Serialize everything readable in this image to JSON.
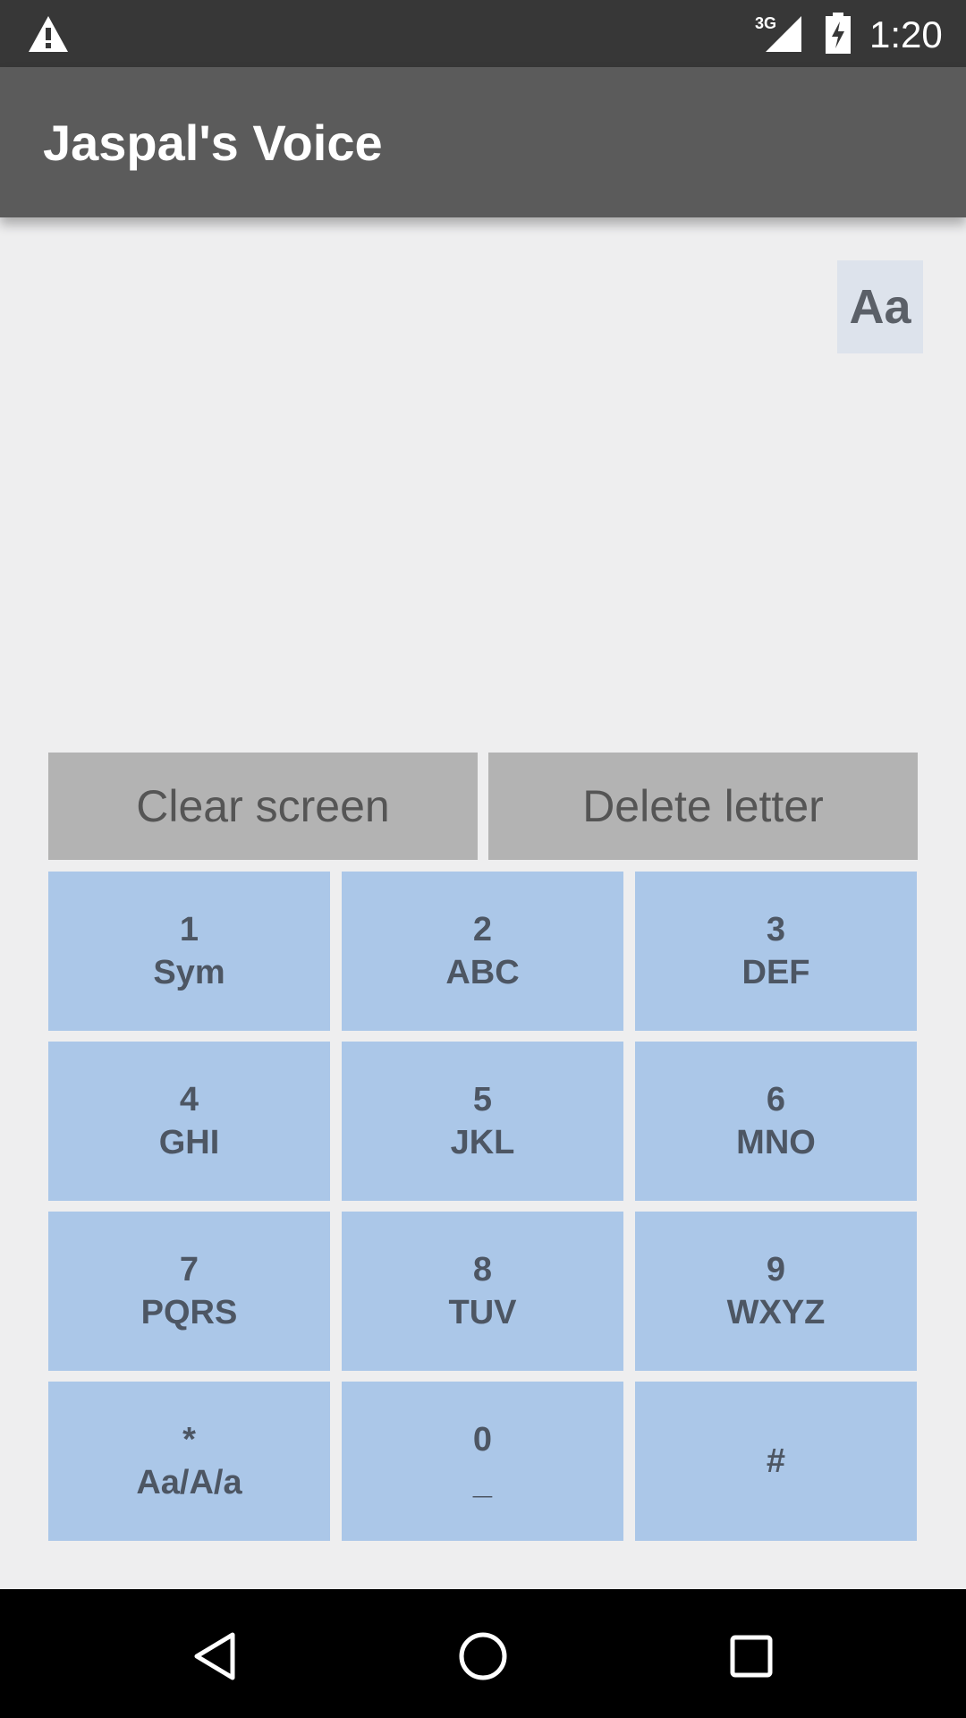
{
  "status_bar": {
    "time": "1:20",
    "network": "3G",
    "warning_icon": "warning-icon",
    "signal_icon": "signal-icon",
    "battery_icon": "battery-charging-icon"
  },
  "app_bar": {
    "title": "Jaspal's Voice"
  },
  "text_area": {
    "case_toggle_label": "Aa"
  },
  "actions": {
    "clear_label": "Clear screen",
    "delete_label": "Delete letter"
  },
  "keypad": {
    "keys": [
      {
        "main": "1",
        "sub": "Sym"
      },
      {
        "main": "2",
        "sub": "ABC"
      },
      {
        "main": "3",
        "sub": "DEF"
      },
      {
        "main": "4",
        "sub": "GHI"
      },
      {
        "main": "5",
        "sub": "JKL"
      },
      {
        "main": "6",
        "sub": "MNO"
      },
      {
        "main": "7",
        "sub": "PQRS"
      },
      {
        "main": "8",
        "sub": "TUV"
      },
      {
        "main": "9",
        "sub": "WXYZ"
      },
      {
        "main": "*",
        "sub": "Aa/A/a"
      },
      {
        "main": "0",
        "sub": "_"
      },
      {
        "main": "#",
        "sub": ""
      }
    ]
  },
  "nav_bar": {
    "back_icon": "back-icon",
    "home_icon": "home-icon",
    "recents_icon": "recents-icon"
  },
  "colors": {
    "status_bar": "#373737",
    "app_bar": "#5b5b5b",
    "background": "#eeeeef",
    "key": "#abc7e8",
    "action_button": "#b3b3b3",
    "key_text": "#4d5663"
  }
}
